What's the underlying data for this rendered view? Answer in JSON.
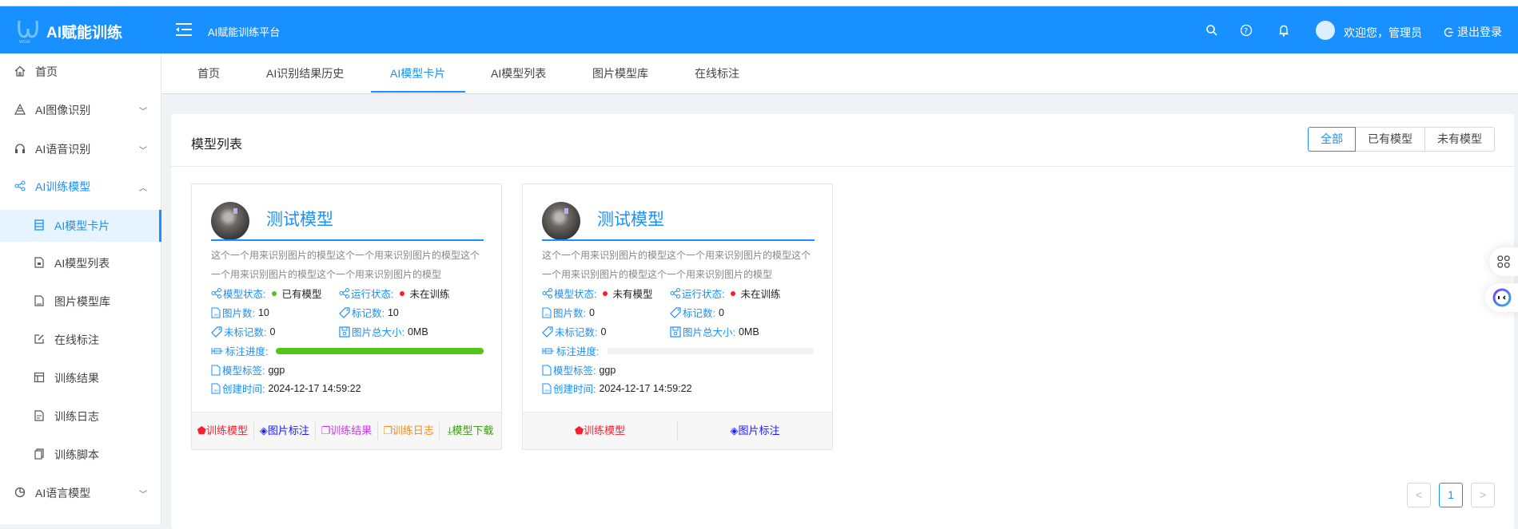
{
  "header": {
    "brand": "AI赋能训练",
    "logo_text": "WGAI",
    "platform": "AI赋能训练平台",
    "welcome": "欢迎您，管理员",
    "logout": "退出登录"
  },
  "sidebar": {
    "items": [
      {
        "label": "首页"
      },
      {
        "label": "AI图像识别"
      },
      {
        "label": "AI语音识别"
      },
      {
        "label": "AI训练模型"
      },
      {
        "label": "AI模型卡片"
      },
      {
        "label": "AI模型列表"
      },
      {
        "label": "图片模型库"
      },
      {
        "label": "在线标注"
      },
      {
        "label": "训练结果"
      },
      {
        "label": "训练日志"
      },
      {
        "label": "训练脚本"
      },
      {
        "label": "AI语言模型"
      }
    ]
  },
  "tabs": [
    {
      "label": "首页"
    },
    {
      "label": "AI识别结果历史"
    },
    {
      "label": "AI模型卡片"
    },
    {
      "label": "AI模型列表"
    },
    {
      "label": "图片模型库"
    },
    {
      "label": "在线标注"
    }
  ],
  "content": {
    "title": "模型列表",
    "filters": [
      {
        "label": "全部"
      },
      {
        "label": "已有模型"
      },
      {
        "label": "未有模型"
      }
    ],
    "labels": {
      "model_status": "模型状态:",
      "run_status": "运行状态:",
      "images": "图片数:",
      "marks": "标记数:",
      "unmarked": "未标记数:",
      "total_size": "图片总大小:",
      "progress": "标注进度:",
      "tag": "模型标签:",
      "created": "创建时间:"
    },
    "cards": [
      {
        "name": "测试模型",
        "desc": "这个一个用来识别图片的模型这个一个用来识别图片的模型这个一个用来识别图片的模型这个一个用来识别图片的模型",
        "model_status": "已有模型",
        "model_status_color": "#52c41a",
        "run_status": "未在训练",
        "run_status_color": "#f5222d",
        "images": "10",
        "marks": "10",
        "unmarked": "0",
        "total_size": "0MB",
        "progress": 100,
        "tag": "ggp",
        "created": "2024-12-17 14:59:22",
        "actions": [
          {
            "label": "训练模型",
            "color": "#f5222d"
          },
          {
            "label": "图片标注",
            "color": "#1a1aff"
          },
          {
            "label": "训练结果",
            "color": "#c63ce6"
          },
          {
            "label": "训练日志",
            "color": "#fa8c16"
          },
          {
            "label": "模型下载",
            "color": "#389e0d"
          }
        ]
      },
      {
        "name": "测试模型",
        "desc": "这个一个用来识别图片的模型这个一个用来识别图片的模型这个一个用来识别图片的模型这个一个用来识别图片的模型",
        "model_status": "未有模型",
        "model_status_color": "#f5222d",
        "run_status": "未在训练",
        "run_status_color": "#f5222d",
        "images": "0",
        "marks": "0",
        "unmarked": "0",
        "total_size": "0MB",
        "progress": 0,
        "tag": "ggp",
        "created": "2024-12-17 14:59:22",
        "actions": [
          {
            "label": "训练模型",
            "color": "#f5222d"
          },
          {
            "label": "图片标注",
            "color": "#1a1aff"
          }
        ]
      }
    ]
  },
  "pagination": {
    "prev": "<",
    "current": "1",
    "next": ">"
  },
  "colors": {
    "primary": "#1890ff",
    "progress": "#52c41a"
  }
}
